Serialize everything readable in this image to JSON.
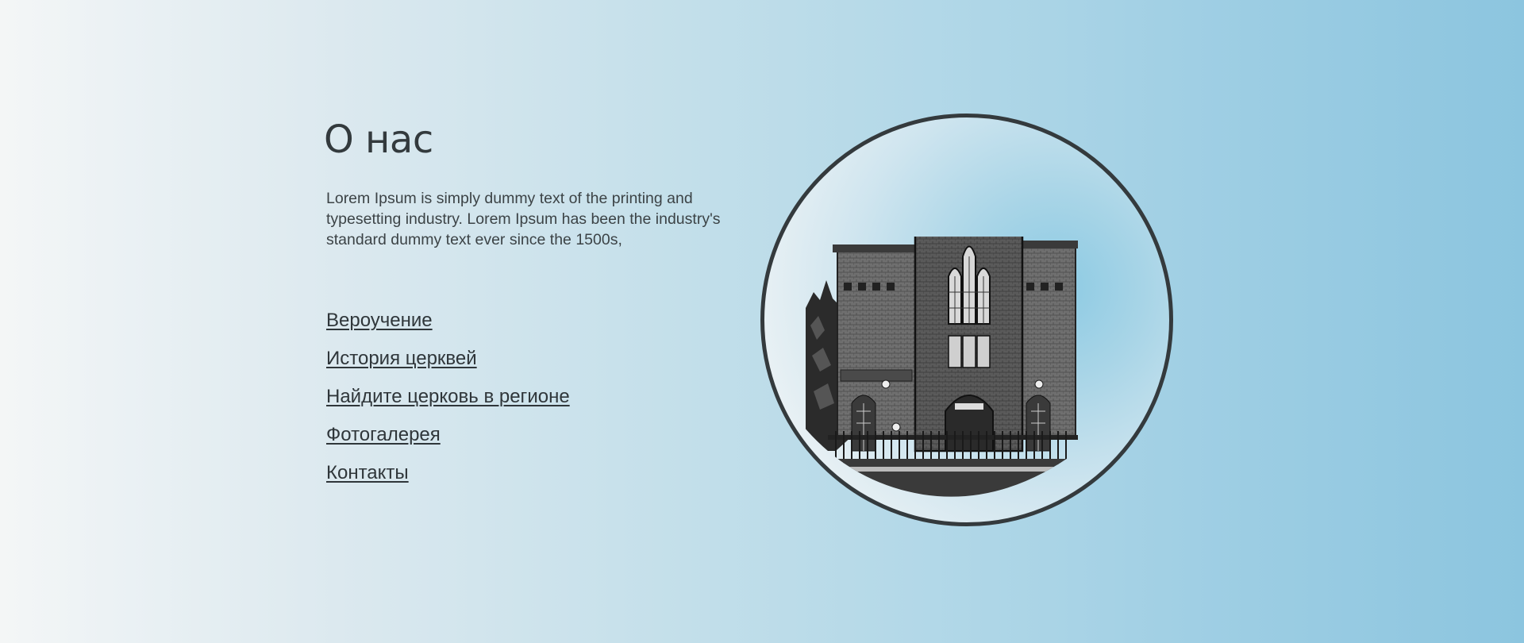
{
  "page": {
    "title": "О нас",
    "intro": "Lorem Ipsum is simply dummy text of the printing and typesetting industry. Lorem Ipsum has been the industry's standard dummy text ever since the 1500s,"
  },
  "nav": {
    "links": [
      "Вероучение",
      "История церквей",
      "Найдите церковь в регионе",
      "Фотогалерея",
      "Контакты"
    ]
  },
  "colors": {
    "text": "#333a3d",
    "frame_border": "#343a3d",
    "gradient_start": "#f4f6f6",
    "gradient_end": "#8cc5df"
  }
}
